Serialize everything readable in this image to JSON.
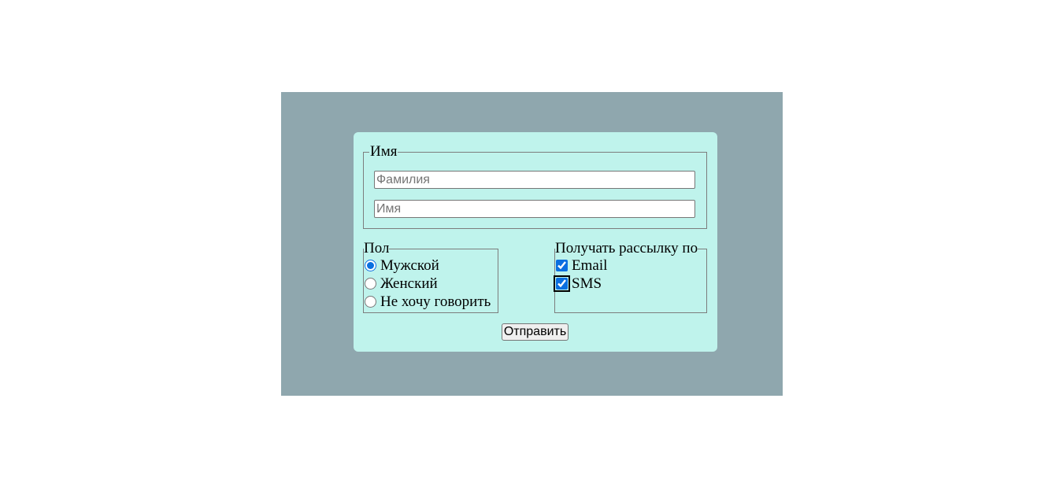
{
  "form": {
    "name_group": {
      "legend": "Имя",
      "surname_placeholder": "Фамилия",
      "surname_value": "",
      "firstname_placeholder": "Имя",
      "firstname_value": ""
    },
    "gender_group": {
      "legend": "Пол",
      "options": [
        {
          "label": "Мужской",
          "checked": true
        },
        {
          "label": "Женский",
          "checked": false
        },
        {
          "label": "Не хочу говорить",
          "checked": false
        }
      ]
    },
    "mailing_group": {
      "legend": "Получать рассылку по",
      "options": [
        {
          "label": "Email",
          "checked": true
        },
        {
          "label": "SMS",
          "checked": true
        }
      ]
    },
    "submit_label": "Отправить"
  },
  "colors": {
    "page_background": "#ffffff",
    "panel_background": "#8fa7ae",
    "card_background": "#bff3ec",
    "accent": "#0a6fe0"
  }
}
